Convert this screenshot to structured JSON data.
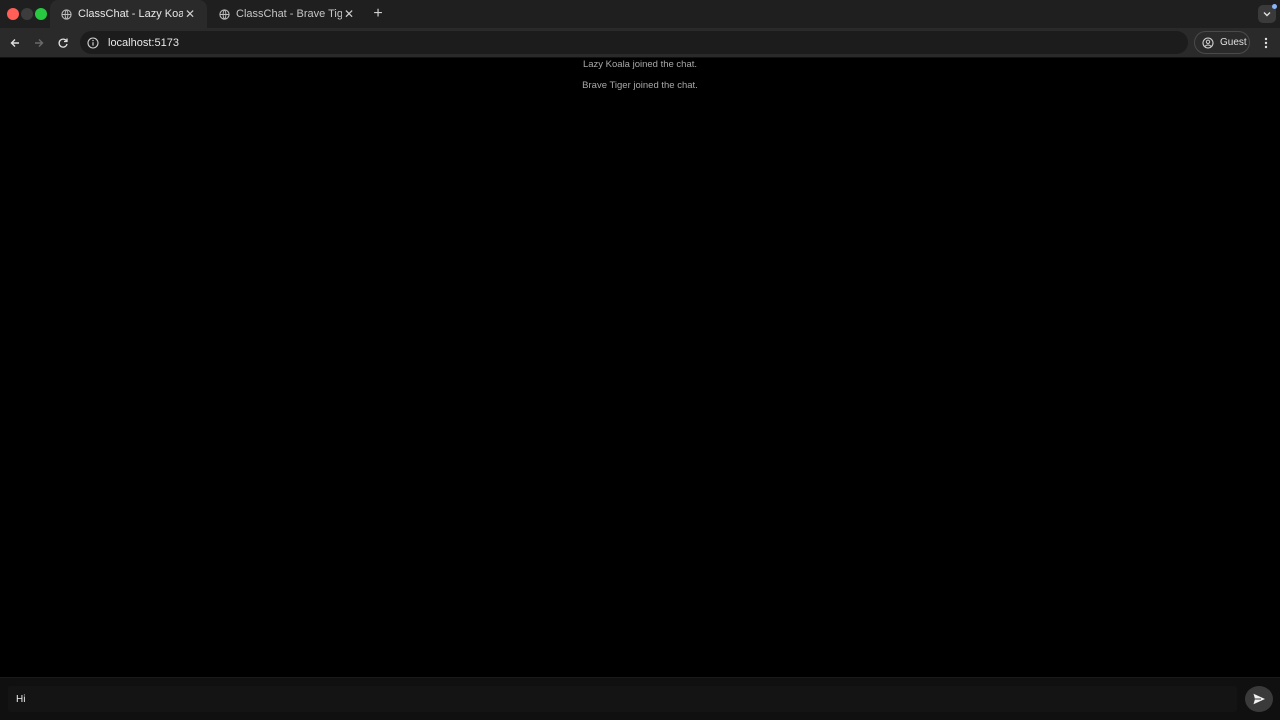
{
  "browser": {
    "tabs": [
      {
        "title": "ClassChat - Lazy Koala",
        "active": true
      },
      {
        "title": "ClassChat - Brave Tiger",
        "active": false
      }
    ],
    "address": "localhost:5173",
    "profile_label": "Guest",
    "icons": {
      "back": "arrow-left-icon",
      "forward": "arrow-right-icon",
      "reload": "reload-icon",
      "site_info": "info-icon",
      "profile": "person-icon",
      "menu": "kebab-menu-icon",
      "new_tab": "plus-icon",
      "tab_search": "chevron-down-icon",
      "send": "send-icon"
    }
  },
  "chat": {
    "system_messages": [
      "Lazy Koala joined the chat.",
      "Brave Tiger joined the chat."
    ],
    "composer": {
      "value": "Hi"
    }
  },
  "colors": {
    "page_background": "#000000",
    "system_message_text": "#a8a8a8",
    "send_button": "#3a3a3a"
  }
}
